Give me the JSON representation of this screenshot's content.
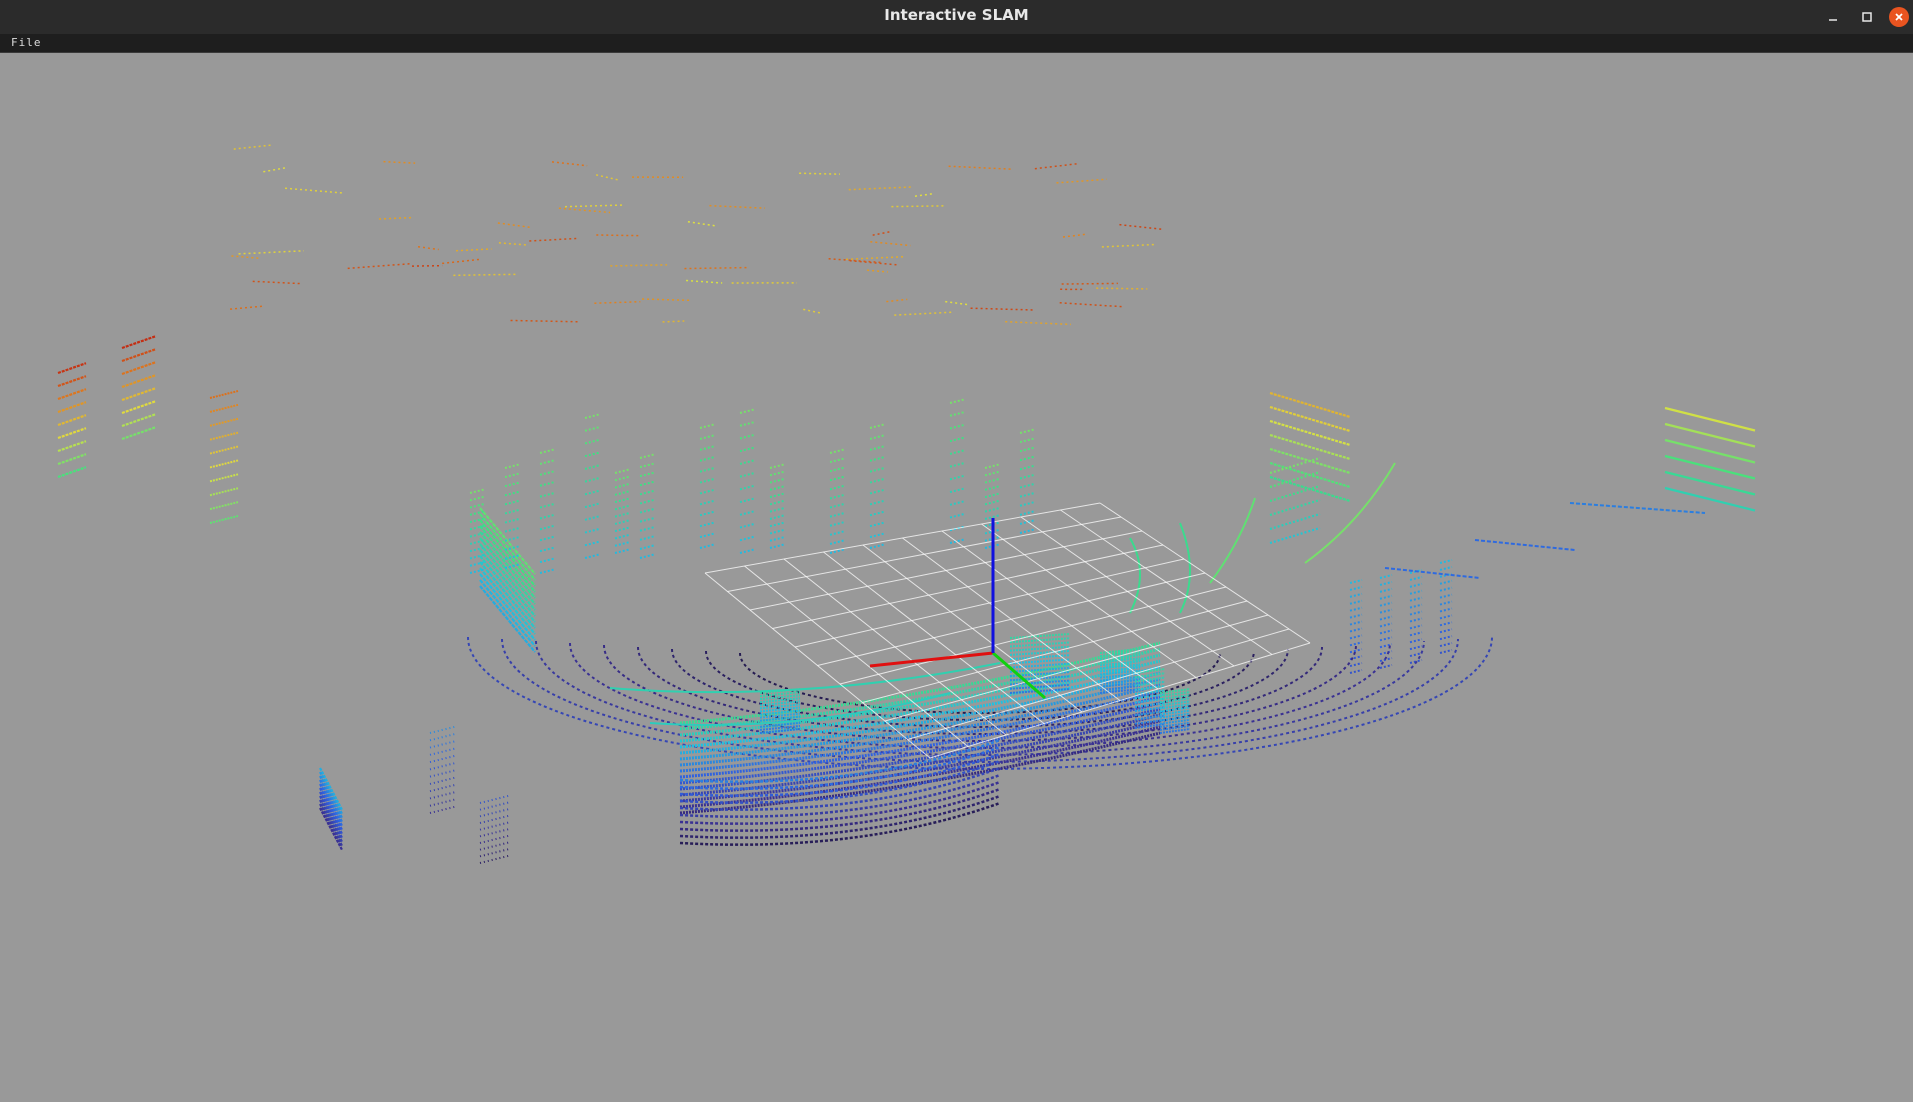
{
  "window": {
    "title": "Interactive SLAM",
    "controls": [
      "minimize-icon",
      "maximize-icon",
      "close-icon"
    ]
  },
  "menubar": {
    "items": [
      {
        "label": "File"
      }
    ]
  },
  "viewport": {
    "background_color": "#999999",
    "axis_colors": {
      "x": "#e01010",
      "y": "#10d010",
      "z": "#1010e0"
    },
    "grid_color": "#ffffff",
    "colormap": [
      "#1a1030",
      "#3a2f8f",
      "#3060e0",
      "#20c0e0",
      "#40e080",
      "#e0e040",
      "#e08020",
      "#c02010"
    ]
  }
}
